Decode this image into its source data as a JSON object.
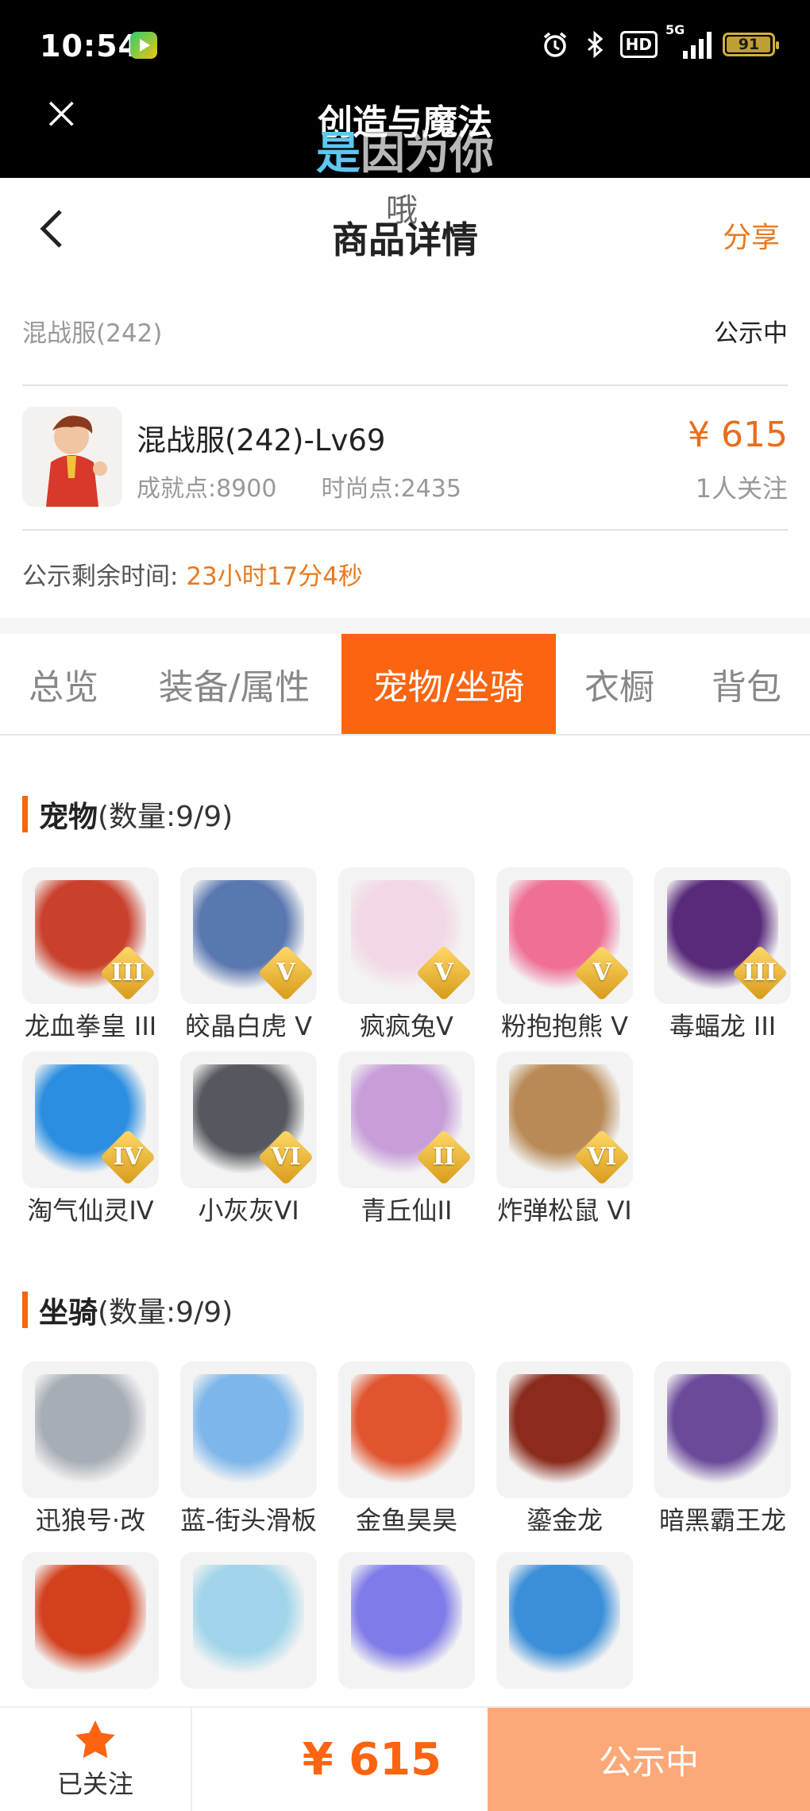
{
  "status_bar": {
    "time": "10:54",
    "hd_badge": "HD",
    "network": "5G",
    "battery": "91"
  },
  "top_overlay": {
    "mini_title": "创造与魔法",
    "lyric_blue": "是",
    "lyric_rest": "因为你",
    "floating_char": "哦"
  },
  "nav": {
    "title": "商品详情",
    "share_label": "分享"
  },
  "listing": {
    "server": "混战服(242)",
    "status": "公示中",
    "product_name": "混战服(242)-Lv69",
    "achievement": "成就点:8900",
    "fashion": "时尚点:2435",
    "price": "¥ 615",
    "followers": "1人关注",
    "countdown_label": "公示剩余时间:",
    "countdown_value": "23小时17分4秒"
  },
  "tabs": [
    {
      "label": "总览",
      "active": false
    },
    {
      "label": "装备/属性",
      "active": false
    },
    {
      "label": "宠物/坐骑",
      "active": true
    },
    {
      "label": "衣橱",
      "active": false
    },
    {
      "label": "背包",
      "active": false
    }
  ],
  "pets": {
    "title": "宠物",
    "count": "(数量:9/9)",
    "items": [
      {
        "name": "龙血拳皇 III",
        "rank": "III",
        "icon": "red-horned-beast",
        "color": "#c9402c"
      },
      {
        "name": "皎晶白虎 V",
        "rank": "V",
        "icon": "white-tiger",
        "color": "#5a78b0"
      },
      {
        "name": "疯疯兔V",
        "rank": "V",
        "icon": "crazy-rabbit",
        "color": "#f2d8e6"
      },
      {
        "name": "粉抱抱熊 V",
        "rank": "V",
        "icon": "pink-bear",
        "color": "#ef6f95"
      },
      {
        "name": "毒蝠龙 III",
        "rank": "III",
        "icon": "purple-bat-dragon",
        "color": "#5a2a7a"
      },
      {
        "name": "淘气仙灵IV",
        "rank": "IV",
        "icon": "blue-spirit-dog",
        "color": "#2b8ee0"
      },
      {
        "name": "小灰灰VI",
        "rank": "VI",
        "icon": "gray-dog",
        "color": "#55585e"
      },
      {
        "name": "青丘仙II",
        "rank": "II",
        "icon": "fox-fairy",
        "color": "#c79ed8"
      },
      {
        "name": "炸弹松鼠 VI",
        "rank": "VI",
        "icon": "bomb-squirrel",
        "color": "#b88a55"
      }
    ]
  },
  "mounts": {
    "title": "坐骑",
    "count": "(数量:9/9)",
    "items": [
      {
        "name": "迅狼号·改",
        "icon": "mech-wolf",
        "color": "#a7adb5"
      },
      {
        "name": "蓝-街头滑板",
        "icon": "blue-skateboard",
        "color": "#7db6ea"
      },
      {
        "name": "金鱼昊昊",
        "icon": "goldfish",
        "color": "#e0552f"
      },
      {
        "name": "鎏金龙",
        "icon": "golden-dragon",
        "color": "#8a2b1c"
      },
      {
        "name": "暗黑霸王龙",
        "icon": "dark-trex",
        "color": "#6a4a9a"
      },
      {
        "name": "",
        "icon": "fire-dragon",
        "color": "#d2401e"
      },
      {
        "name": "",
        "icon": "cloud-sheep",
        "color": "#9fd4ea"
      },
      {
        "name": "",
        "icon": "rainbow-wing",
        "color": "#7f7be8"
      },
      {
        "name": "",
        "icon": "ice-dragon",
        "color": "#3a8fd8"
      }
    ]
  },
  "bottom_bar": {
    "follow_label": "已关注",
    "price": "¥ 615",
    "action_label": "公示中"
  },
  "colors": {
    "accent": "#fb6410",
    "price_orange": "#ea6d1b",
    "action_button": "#fca878"
  }
}
